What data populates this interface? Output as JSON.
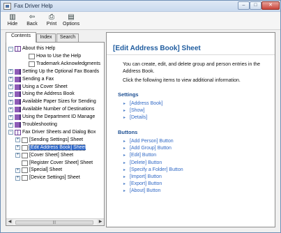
{
  "window": {
    "title": "Fax Driver Help",
    "buttons": [
      "–",
      "□",
      "✕"
    ]
  },
  "toolbar": [
    {
      "label": "Hide",
      "icon": "hide-icon"
    },
    {
      "label": "Back",
      "icon": "back-icon"
    },
    {
      "label": "Print",
      "icon": "print-icon"
    },
    {
      "label": "Options",
      "icon": "options-icon"
    }
  ],
  "tabs": [
    "Contents",
    "Index",
    "Search"
  ],
  "tree": [
    {
      "label": "About this Help",
      "icon": "openbook",
      "expand": "−",
      "indent": 0
    },
    {
      "label": "How to Use the Help",
      "icon": "page",
      "expand": "",
      "indent": 2
    },
    {
      "label": "Trademark Acknowledgments",
      "icon": "page",
      "expand": "",
      "indent": 2
    },
    {
      "label": "Setting Up the Optional Fax Boards",
      "icon": "book",
      "expand": "+",
      "indent": 0
    },
    {
      "label": "Sending a Fax",
      "icon": "book",
      "expand": "+",
      "indent": 0
    },
    {
      "label": "Using a Cover Sheet",
      "icon": "book",
      "expand": "+",
      "indent": 0
    },
    {
      "label": "Using the Address Book",
      "icon": "book",
      "expand": "+",
      "indent": 0
    },
    {
      "label": "Available Paper Sizes for Sending",
      "icon": "book",
      "expand": "+",
      "indent": 0
    },
    {
      "label": "Available Number of Destinations",
      "icon": "book",
      "expand": "+",
      "indent": 0
    },
    {
      "label": "Using the Department ID Manage",
      "icon": "book",
      "expand": "+",
      "indent": 0
    },
    {
      "label": "Troubleshooting",
      "icon": "book",
      "expand": "+",
      "indent": 0
    },
    {
      "label": "Fax Driver Sheets and Dialog Box",
      "icon": "openbook",
      "expand": "−",
      "indent": 0
    },
    {
      "label": "[Sending Settings] Sheet",
      "icon": "page",
      "expand": "+",
      "indent": 1
    },
    {
      "label": "[Edit Address Book] Sheet",
      "icon": "page",
      "expand": "+",
      "indent": 1,
      "selected": true
    },
    {
      "label": "[Cover Sheet] Sheet",
      "icon": "page",
      "expand": "+",
      "indent": 1
    },
    {
      "label": "[Register Cover Sheet] Sheet",
      "icon": "page",
      "expand": "",
      "indent": 1
    },
    {
      "label": "[Special] Sheet",
      "icon": "page",
      "expand": "+",
      "indent": 1
    },
    {
      "label": "[Device Settings] Sheet",
      "icon": "page",
      "expand": "+",
      "indent": 1
    }
  ],
  "content": {
    "title": "[Edit Address Book] Sheet",
    "description_1": "You can create, edit, and delete group and person entries in the Address Book.",
    "description_2": "Click the following items to view additional information.",
    "settings_title": "Settings",
    "settings": [
      "[Address Book]",
      "[Show]",
      "[Details]"
    ],
    "buttons_title": "Buttons",
    "buttons": [
      "[Add Person] Button",
      "[Add Group] Button",
      "[Edit] Button",
      "[Delete] Button",
      "[Specify a Folder] Button",
      "[Import] Button",
      "[Export] Button",
      "[About] Button"
    ]
  }
}
